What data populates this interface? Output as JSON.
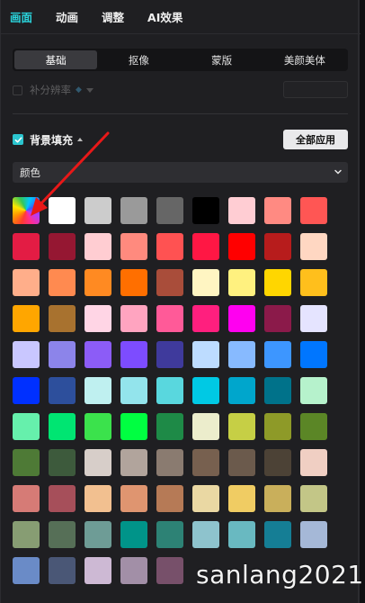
{
  "top_tabs": [
    {
      "label": "画面",
      "active": true
    },
    {
      "label": "动画",
      "active": false
    },
    {
      "label": "调整",
      "active": false
    },
    {
      "label": "AI效果",
      "active": false
    }
  ],
  "sub_tabs": [
    {
      "label": "基础",
      "active": true
    },
    {
      "label": "抠像",
      "active": false
    },
    {
      "label": "蒙版",
      "active": false
    },
    {
      "label": "美颜美体",
      "active": false
    }
  ],
  "upscale": {
    "label": "补分辨率",
    "icon": "diamond-icon",
    "enabled": false
  },
  "background_fill": {
    "label": "背景填充",
    "checked": true,
    "apply_all_label": "全部应用"
  },
  "fill_type": {
    "selected": "颜色"
  },
  "palette": {
    "accent": "#2bc5cf",
    "rows": [
      [
        "rainbow",
        "#ffffff",
        "#cccccc",
        "#9a9a9a",
        "#666666",
        "#000000",
        "#ffcdd3",
        "#ff8a82",
        "#ff5654"
      ],
      [
        "#e31c44",
        "#951732",
        "#ffcdd2",
        "#ff8a7e",
        "#ff5252",
        "#ff1744",
        "#ff0000",
        "#b71c1c",
        "#ffd7c2"
      ],
      [
        "#ffae8a",
        "#ff8a50",
        "#ff8a22",
        "#ff6f00",
        "#a94d3a",
        "#fff5c2",
        "#fff17f",
        "#ffd600",
        "#ffbf1c"
      ],
      [
        "#ffa600",
        "#a8722f",
        "#ffd5e5",
        "#ffa4c0",
        "#ff5a98",
        "#ff1f7e",
        "#ff00f0",
        "#8b1a4a",
        "#e5e4ff"
      ],
      [
        "#c9c7ff",
        "#8c84ea",
        "#8c5cf7",
        "#7d4cff",
        "#3f3a9c",
        "#bddcff",
        "#87baff",
        "#3d96ff",
        "#0076ff"
      ],
      [
        "#0030ff",
        "#2d4f9c",
        "#bff0f0",
        "#93e4ec",
        "#59d7de",
        "#00c9e4",
        "#00a6cc",
        "#00728a",
        "#b6f2cc"
      ],
      [
        "#66f0ac",
        "#00e572",
        "#3be24c",
        "#00ff41",
        "#1e8a47",
        "#ecedcc",
        "#c6cf45",
        "#8e9a28",
        "#5b8626"
      ],
      [
        "#4e7a36",
        "#3d5a3c",
        "#d7cec9",
        "#b1a49c",
        "#8a7b70",
        "#77604f",
        "#6b5a4c",
        "#4c4236",
        "#f0cfc3"
      ],
      [
        "#d67b76",
        "#a64f5a",
        "#f2c090",
        "#df9570",
        "#b67a56",
        "#ead8a3",
        "#f0cc63",
        "#c9af5b",
        "#c3c687"
      ],
      [
        "#879d73",
        "#566f57",
        "#6e9c96",
        "#009489",
        "#2d8275",
        "#8ec3cd",
        "#69b9c1",
        "#157e95",
        "#a5b8d7"
      ],
      [
        "#6a8bc7",
        "#4a5776",
        "#cdb9d4",
        "#a28fa7",
        "#77506a"
      ]
    ]
  },
  "watermark": "sanlang2021"
}
